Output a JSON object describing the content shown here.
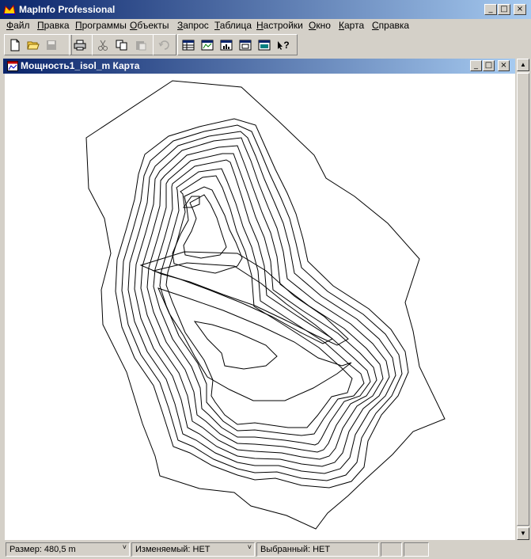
{
  "app": {
    "title": "MapInfo Professional"
  },
  "menu": [
    "Файл",
    "Правка",
    "Программы",
    "Объекты",
    "Запрос",
    "Таблица",
    "Настройки",
    "Окно",
    "Карта",
    "Справка"
  ],
  "toolbar": {
    "icons": [
      "new-icon",
      "open-icon",
      "save-icon",
      "print-icon",
      "cut-icon",
      "copy-icon",
      "paste-icon",
      "undo-icon",
      "browser-icon",
      "map-window-icon",
      "graph-icon",
      "layout-icon",
      "statistics-icon",
      "help-pointer-icon"
    ],
    "help_label": "?"
  },
  "window": {
    "title": "Мощность1_isol_m Карта"
  },
  "status": {
    "size": "Размер: 480,5 m",
    "editable": "Изменяемый: НЕТ",
    "selected": "Выбранный: НЕТ"
  },
  "colors": {
    "titlebar": "#0a246a",
    "face": "#d4d0c8",
    "map_bg": "#ffffff",
    "contour": "#000000"
  }
}
